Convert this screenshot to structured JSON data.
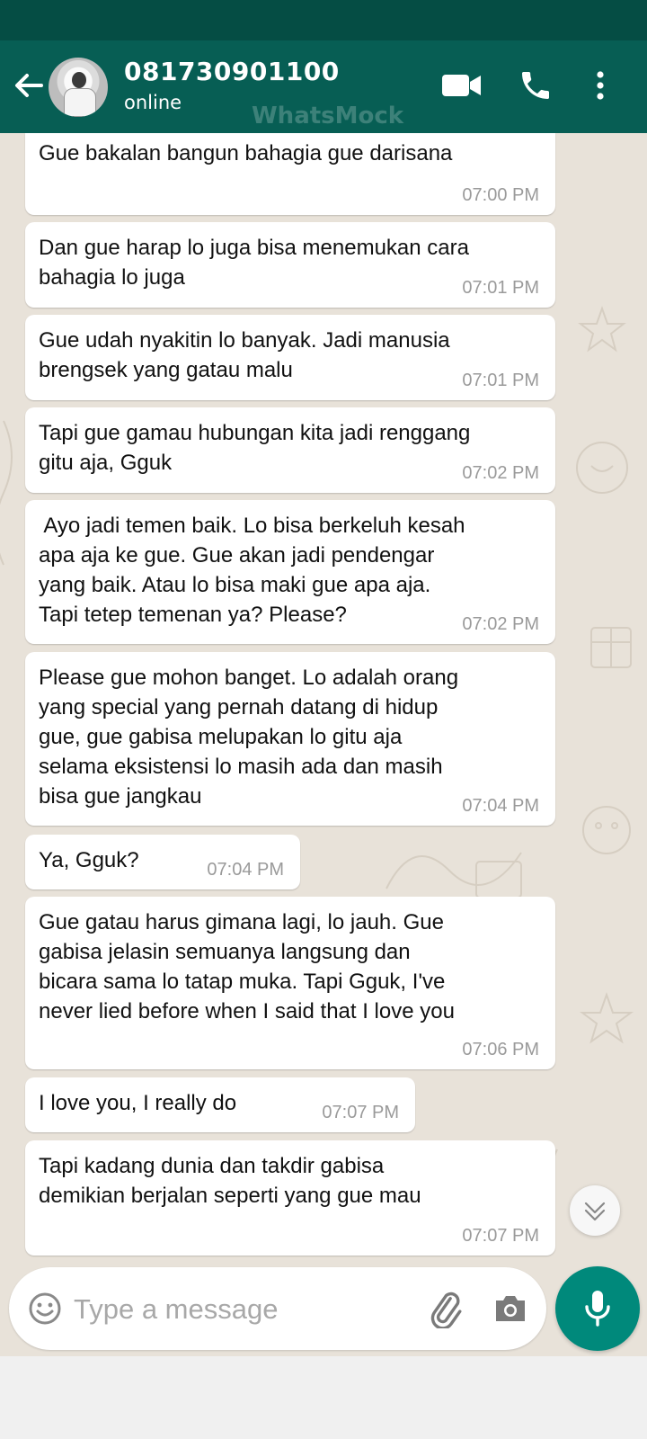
{
  "header": {
    "contact_name": "081730901100",
    "contact_status": "online",
    "watermark": "WhatsMock",
    "icons": [
      "back-arrow-icon",
      "video-call-icon",
      "phone-icon",
      "more-options-icon"
    ]
  },
  "messages": [
    {
      "text": "Gue bakalan bangun bahagia gue darisana",
      "time": "07:00 PM"
    },
    {
      "text": "Dan gue harap lo juga bisa menemukan cara\nbahagia lo juga",
      "time": "07:01 PM"
    },
    {
      "text": "Gue udah nyakitin lo banyak. Jadi manusia\nbrengsek yang gatau malu",
      "time": "07:01 PM"
    },
    {
      "text": "Tapi gue gamau hubungan kita jadi renggang\ngitu aja, Gguk",
      "time": "07:02 PM"
    },
    {
      "text": " Ayo jadi temen baik. Lo bisa berkeluh kesah\napa aja ke gue. Gue akan jadi pendengar\nyang baik. Atau lo bisa maki gue apa aja.\nTapi tetep temenan ya? Please?",
      "time": "07:02 PM"
    },
    {
      "text": "Please gue mohon banget. Lo adalah orang\nyang special yang pernah datang di hidup\ngue, gue gabisa melupakan lo gitu aja\nselama eksistensi lo masih ada dan masih\nbisa gue jangkau",
      "time": "07:04 PM"
    },
    {
      "text": "Ya, Gguk?",
      "time": "07:04 PM"
    },
    {
      "text": "Gue gatau harus gimana lagi, lo jauh. Gue\ngabisa jelasin semuanya langsung dan\nbicara sama lo tatap muka. Tapi Gguk, I've\nnever lied before when I said that I love you",
      "time": "07:06 PM"
    },
    {
      "text": "I love you, I really do",
      "time": "07:07 PM"
    },
    {
      "text": "Tapi kadang dunia dan takdir gabisa\ndemikian berjalan seperti yang gue mau",
      "time": "07:07 PM"
    }
  ],
  "composer": {
    "placeholder": "Type a message",
    "value": "",
    "icons": [
      "emoji-icon",
      "attach-icon",
      "camera-icon",
      "mic-icon"
    ]
  },
  "colors": {
    "header": "#075e54",
    "status_bar": "#054d44",
    "chat_background": "#e8e2d9",
    "bubble": "#ffffff",
    "accent": "#00897b"
  }
}
